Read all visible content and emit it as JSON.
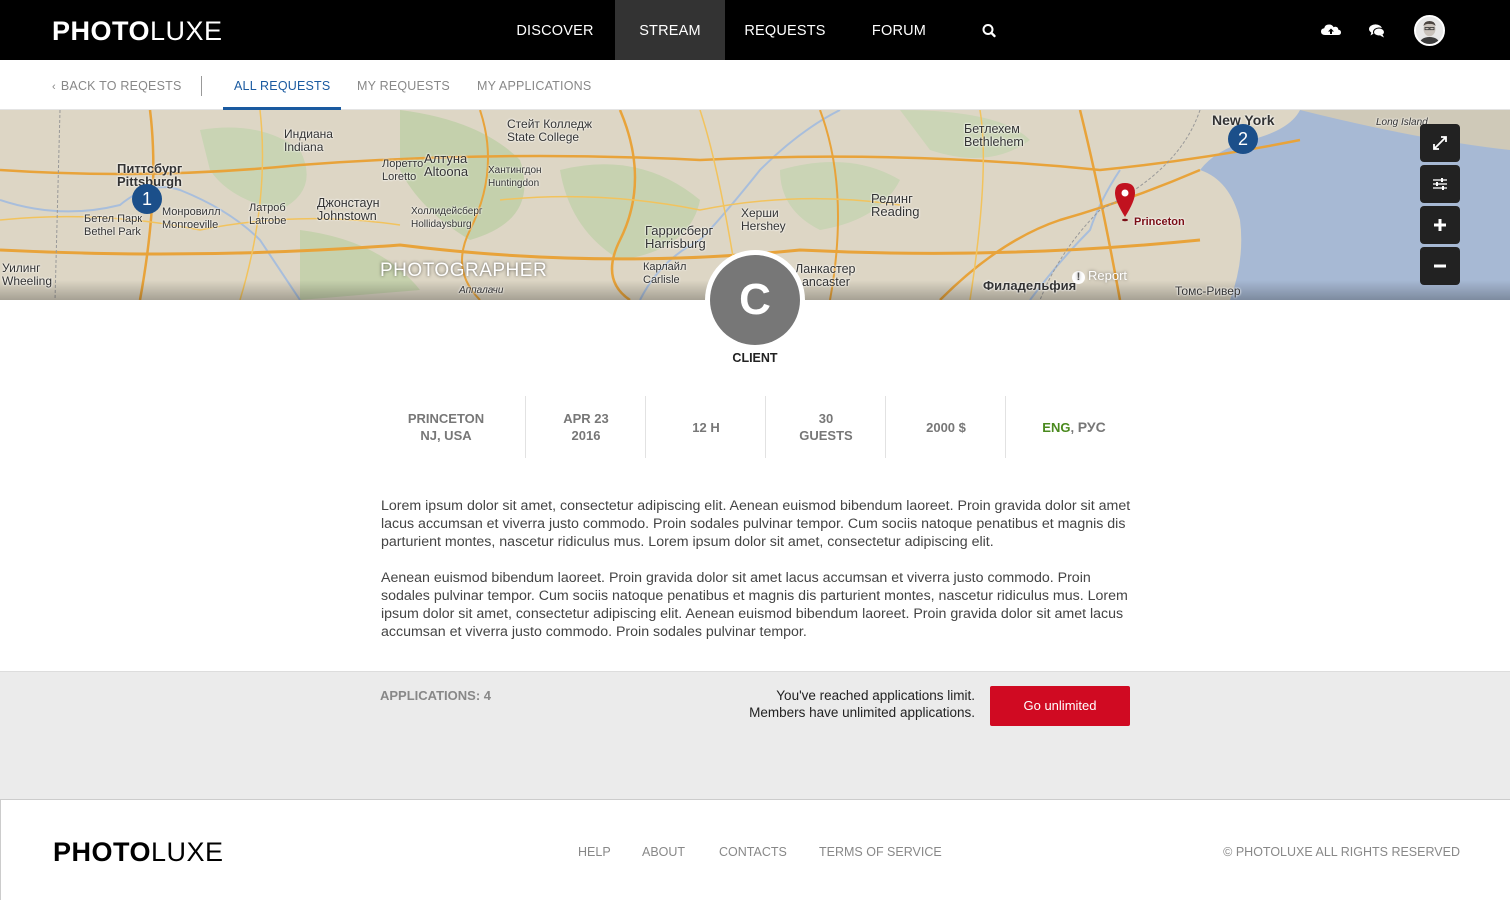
{
  "header": {
    "logo_bold": "PHOTO",
    "logo_light": "LUXE",
    "nav": [
      {
        "label": "DISCOVER",
        "active": false
      },
      {
        "label": "STREAM",
        "active": true
      },
      {
        "label": "REQUESTS",
        "active": false
      },
      {
        "label": "FORUM",
        "active": false
      }
    ],
    "icons": [
      "search-icon",
      "cloud-upload-icon",
      "chat-icon",
      "avatar"
    ]
  },
  "subnav": {
    "back_label": "BACK TO REQESTS",
    "tabs": [
      {
        "label": "ALL REQUESTS",
        "active": true
      },
      {
        "label": "MY REQUESTS",
        "active": false
      },
      {
        "label": "MY APPLICATIONS",
        "active": false
      }
    ]
  },
  "map": {
    "labels": {
      "pittsburgh_ru": "Питтсбург",
      "pittsburgh_en": "Pittsburgh",
      "indiana_ru": "Индиана",
      "indiana_en": "Indiana",
      "loretto_ru": "Лоретто",
      "loretto_en": "Loretto",
      "altoona_ru": "Алтуна",
      "altoona_en": "Altoona",
      "state_college_ru": "Стейт Колледж",
      "state_college_en": "State College",
      "huntingdon_ru": "Хантингдон",
      "huntingdon_en": "Huntingdon",
      "bethel_ru": "Бетел Парк",
      "bethel_en": "Bethel Park",
      "monroeville_ru": "Монровилл",
      "monroeville_en": "Monroeville",
      "latrobe_ru": "Латроб",
      "latrobe_en": "Latrobe",
      "johnstown_ru": "Джонстаун",
      "johnstown_en": "Johnstown",
      "hollidaysburg_ru": "Холлидейсберг",
      "hollidaysburg_en": "Hollidaysburg",
      "wheeling_ru": "Уилинг",
      "wheeling_en": "Wheeling",
      "appalachians_ru": "Аппалачи",
      "harrisburg_ru": "Гаррисберг",
      "harrisburg_en": "Harrisburg",
      "carlisle_ru": "Карлайл",
      "carlisle_en": "Carlisle",
      "hershey_ru": "Херши",
      "hershey_en": "Hershey",
      "reading_ru": "Рединг",
      "reading_en": "Reading",
      "lancaster_ru": "Ланкастер",
      "lancaster_en": "Lancaster",
      "bethlehem_ru": "Бетлехем",
      "bethlehem_en": "Bethlehem",
      "philadelphia_ru": "Филадельфия",
      "new_york_en": "New York",
      "long_island_en": "Long Island",
      "toms_river_ru": "Томс-Ривер",
      "princeton": "Princeton"
    },
    "clusters": [
      "1",
      "2"
    ],
    "controls": [
      "fullscreen-icon",
      "filter-icon",
      "zoom-in-icon",
      "zoom-out-icon"
    ],
    "role_label": "PHOTOGRAPHER",
    "report_label": "Report",
    "pin_color": "#c1121f"
  },
  "client": {
    "initial": "C",
    "label": "CLIENT"
  },
  "stats": {
    "location_line1": "PRINCETON",
    "location_line2": "NJ, USA",
    "date_line1": "APR 23",
    "date_line2": "2016",
    "duration": "12 H",
    "guests_line1": "30",
    "guests_line2": "GUESTS",
    "budget": "2000 $",
    "lang_primary": "ENG",
    "lang_sep": ", ",
    "lang_secondary": "РУС"
  },
  "description": {
    "paragraph1": "Lorem ipsum dolor sit amet, consectetur adipiscing elit. Aenean euismod bibendum laoreet. Proin gravida dolor sit amet lacus accumsan et viverra justo commodo. Proin sodales pulvinar tempor. Cum sociis natoque penatibus et magnis dis parturient montes, nascetur ridiculus mus. Lorem ipsum dolor sit amet, consectetur adipiscing elit.",
    "paragraph2": "Aenean euismod bibendum laoreet. Proin gravida dolor sit amet lacus accumsan et viverra justo commodo. Proin sodales pulvinar tempor. Cum sociis natoque penatibus et magnis dis parturient montes, nascetur ridiculus mus. Lorem ipsum dolor sit amet, consectetur adipiscing elit. Aenean euismod bibendum laoreet. Proin gravida dolor sit amet lacus accumsan et viverra justo commodo. Proin sodales pulvinar tempor."
  },
  "applications": {
    "count_label": "APPLICATIONS: 4",
    "limit_line1": "You've reached applications limit.",
    "limit_line2": "Members have unlimited applications.",
    "cta_label": "Go unlimited",
    "cta_color": "#d00a22"
  },
  "footer": {
    "logo_bold": "PHOTO",
    "logo_light": "LUXE",
    "links": [
      "HELP",
      "ABOUT",
      "CONTACTS",
      "TERMS OF SERVICE"
    ],
    "copyright": "© PHOTOLUXE ALL RIGHTS  RESERVED"
  }
}
